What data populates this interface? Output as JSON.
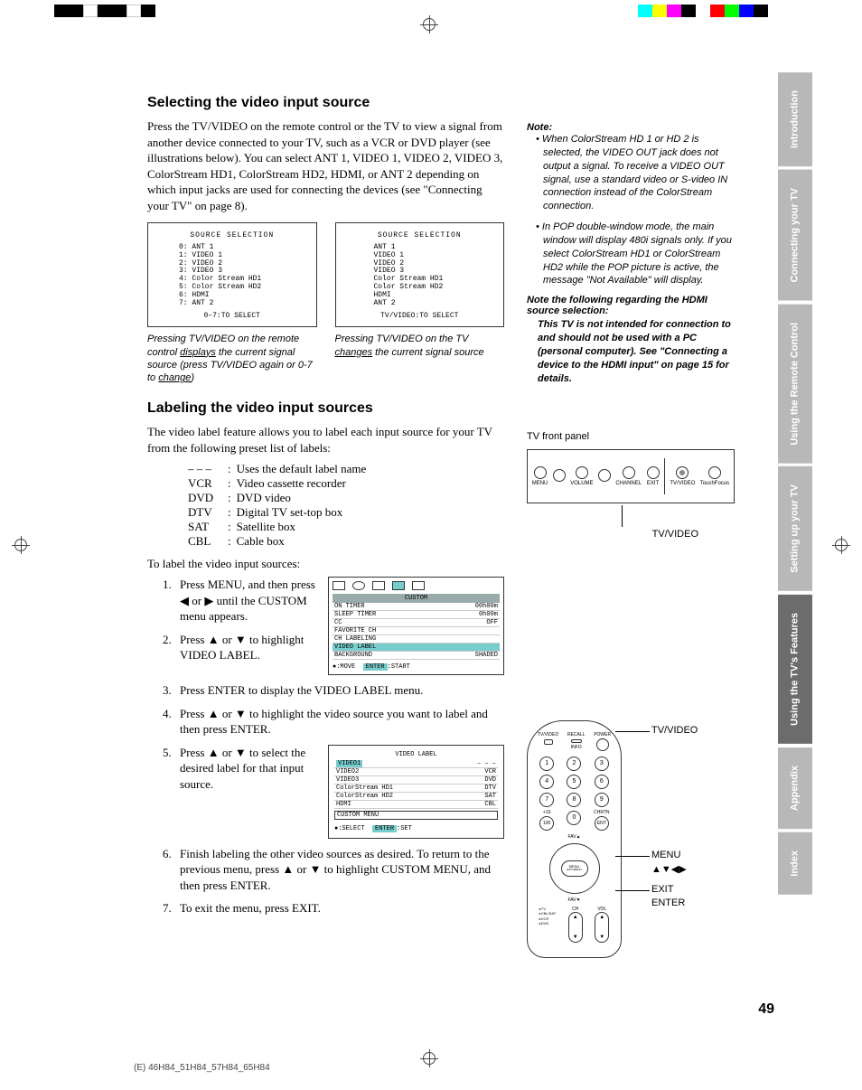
{
  "h1": "Selecting the video input source",
  "p1": "Press the TV/VIDEO on the remote control or the TV to view a signal from another device connected to your TV, such as a VCR or DVD player (see illustrations below). You can select ANT 1, VIDEO 1, VIDEO 2, VIDEO 3, ColorStream HD1, ColorStream HD2, HDMI, or ANT 2 depending on which input jacks are used for connecting the devices (see \"Connecting your TV\" on page 8).",
  "screen1": {
    "title": "SOURCE SELECTION",
    "lines": [
      "0: ANT 1",
      "1: VIDEO 1",
      "2: VIDEO 2",
      "3: VIDEO 3",
      "4: Color Stream HD1",
      "5: Color Stream HD2",
      "6: HDMI",
      "7: ANT 2"
    ],
    "footer": "0–7:TO SELECT"
  },
  "screen2": {
    "title": "SOURCE SELECTION",
    "lines": [
      "ANT 1",
      "VIDEO 1",
      "VIDEO 2",
      "VIDEO 3",
      "Color Stream HD1",
      "Color Stream HD2",
      "HDMI",
      "ANT 2"
    ],
    "footer": "TV/VIDEO:TO SELECT"
  },
  "cap1a": "Pressing TV/VIDEO on the remote control ",
  "cap1b": "displays",
  "cap1c": " the current signal source (press TV/VIDEO again or 0-7 to ",
  "cap1d": "change",
  "cap1e": ")",
  "cap2a": "Pressing TV/VIDEO on the TV ",
  "cap2b": "changes",
  "cap2c": " the current signal source",
  "h2": "Labeling the video input sources",
  "p2": "The video label feature allows you to label each input source for your TV from the following preset list of labels:",
  "labels": [
    [
      "– – –",
      "Uses the default label name"
    ],
    [
      "VCR",
      "Video cassette recorder"
    ],
    [
      "DVD",
      "DVD video"
    ],
    [
      "DTV",
      "Digital TV set-top box"
    ],
    [
      "SAT",
      "Satellite box"
    ],
    [
      "CBL",
      "Cable box"
    ]
  ],
  "p3": "To label the video input sources:",
  "steps": [
    "Press MENU, and then press ◀ or ▶ until the CUSTOM menu appears.",
    "Press ▲ or ▼ to highlight VIDEO LABEL.",
    "Press ENTER to display the VIDEO LABEL menu.",
    "Press ▲ or ▼ to highlight the video source you want to label and then press ENTER.",
    "Press ▲ or ▼ to select the desired label for that input source.",
    "Finish labeling the other video sources as desired. To return to the previous menu, press ▲ or ▼ to highlight CUSTOM MENU, and then press ENTER.",
    "To exit the menu, press EXIT."
  ],
  "custom_menu": {
    "title": "CUSTOM",
    "rows": [
      [
        "ON TIMER",
        "00h00m"
      ],
      [
        "SLEEP TIMER",
        "0h00m"
      ],
      [
        "CC",
        "OFF"
      ],
      [
        "FAVORITE CH",
        ""
      ],
      [
        "CH LABELING",
        ""
      ],
      [
        "VIDEO LABEL",
        ""
      ],
      [
        "BACKGROUND",
        "SHADED"
      ]
    ],
    "foot1": "●:MOVE",
    "foot2": "ENTER",
    "foot3": ":START"
  },
  "videolabel_menu": {
    "title": "VIDEO LABEL",
    "rows": [
      [
        "VIDEO1",
        "– – –"
      ],
      [
        "VIDEO2",
        "VCR"
      ],
      [
        "VIDEO3",
        "DVD"
      ],
      [
        "ColorStream HD1",
        "DTV"
      ],
      [
        "ColorStream HD2",
        "SAT"
      ],
      [
        "HDMI",
        "CBL"
      ],
      [
        "CUSTOM MENU",
        ""
      ]
    ],
    "foot1": "●:SELECT",
    "foot2": "ENTER",
    "foot3": ":SET"
  },
  "note_h": "Note:",
  "note1": "When ColorStream HD 1 or HD 2 is selected, the VIDEO OUT jack does not output a signal. To receive a VIDEO OUT signal, use a standard video or S-video IN connection instead of the ColorStream connection.",
  "note2": "In POP double-window mode, the main window will display 480i signals only. If you select ColorStream HD1 or ColorStream HD2 while the POP picture is active, the message \"Not Available\" will display.",
  "note_hdmi_h": "Note the following regarding the HDMI source selection:",
  "note_hdmi": "This TV is not intended for connection to and should not be used with a PC (personal computer). See \"Connecting a device to the HDMI input\" on page 15 for details.",
  "panel_label": "TV front panel",
  "panel_buttons": [
    "MENU",
    "VOLUME",
    "VOLUME",
    "CHANNEL",
    "CHANNEL",
    "EXIT",
    "TV/VIDEO",
    "TouchFocus"
  ],
  "panel_callout": "TV/VIDEO",
  "remote_labels": {
    "tvvideo": "TV/VIDEO",
    "recall": "RECALL",
    "power": "POWER",
    "info": "INFO",
    "chrtn": "CHRTN",
    "menu": "MENU",
    "exitmenu": "EXIT/MENU",
    "ch": "CH",
    "vol": "VOL",
    "fav_up": "FAV▲",
    "fav_down": "FAV▼",
    "side1": "+10",
    "tv": "TV",
    "cblsat": "CBL/SAT",
    "vcr": "VCR",
    "dvd": "DVD",
    "ent": "ENT",
    "n100": "100"
  },
  "callouts": {
    "tvvideo": "TV/VIDEO",
    "menu": "MENU",
    "arrows": "▲▼◀▶",
    "exit": "EXIT",
    "enter": "ENTER"
  },
  "tabs": [
    "Introduction",
    "Connecting your TV",
    "Using the Remote Control",
    "Setting up your TV",
    "Using the TV's Features",
    "Appendix",
    "Index"
  ],
  "active_tab": 4,
  "page_num": "49",
  "footer": "(E) 46H84_51H84_57H84_65H84"
}
